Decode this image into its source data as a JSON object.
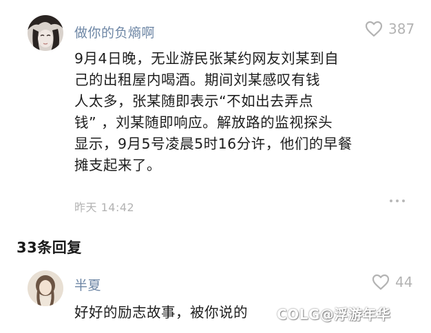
{
  "comment": {
    "author": "做你的负熵啊",
    "likes": "387",
    "lines": [
      "9月4日晚，无业游民张某约网友刘某到自",
      "己的出租屋内喝酒。期间刘某感叹有钱",
      "人太多，张某随即表示“不如出去弄点",
      "钱” ，刘某随即响应。解放路的监视探头",
      "显示，9月5号凌晨5时16分许，他们的早餐",
      "摊支起来了。"
    ],
    "time": "昨天 14:42"
  },
  "replies_header": "33条回复",
  "reply": {
    "author": "半夏",
    "likes": "44",
    "text": "好好的励志故事，被你说的"
  },
  "watermark": "COLG@浮游年华",
  "colors": {
    "author_name": "#6d86a5",
    "muted": "#b3b3b3",
    "text": "#1e1e1e"
  },
  "icons": {
    "like": "heart-outline-icon",
    "more": "more-dots-icon"
  }
}
